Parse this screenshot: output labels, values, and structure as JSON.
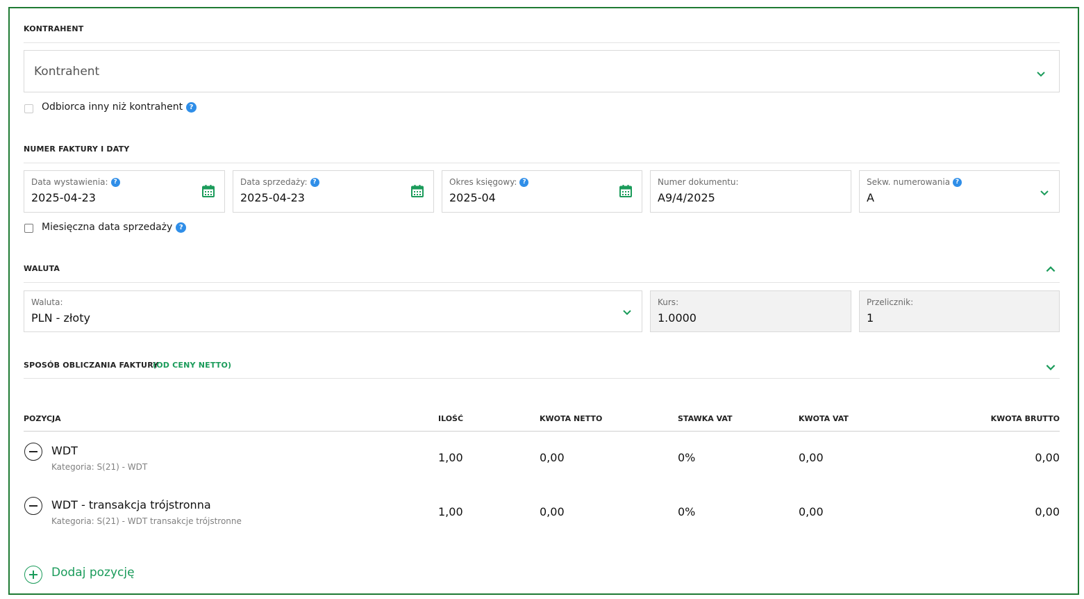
{
  "theme": {
    "accent": "#1a9b5a",
    "frame_border": "#1e7a33",
    "help_blue": "#2f8ee8"
  },
  "kontrahent": {
    "section_title": "KONTRAHENT",
    "select_placeholder": "Kontrahent",
    "recipient_checkbox_label": "Odbiorca inny niż kontrahent",
    "recipient_checked": false
  },
  "numer": {
    "section_title": "NUMER FAKTURY I DATY",
    "issue_date": {
      "label": "Data wystawienia:",
      "value": "2025-04-23"
    },
    "sale_date": {
      "label": "Data sprzedaży:",
      "value": "2025-04-23"
    },
    "period": {
      "label": "Okres księgowy:",
      "value": "2025-04"
    },
    "doc_number": {
      "label": "Numer dokumentu:",
      "value": "A9/4/2025"
    },
    "sequence": {
      "label": "Sekw. numerowania",
      "value": "A"
    },
    "monthly_checkbox_label": "Miesięczna data sprzedaży",
    "monthly_checked": false
  },
  "waluta": {
    "section_title": "WALUTA",
    "currency": {
      "label": "Waluta:",
      "value": "PLN - złoty"
    },
    "rate": {
      "label": "Kurs:",
      "value": "1.0000"
    },
    "converter": {
      "label": "Przelicznik:",
      "value": "1"
    }
  },
  "calc": {
    "section_title": "SPOSÓB OBLICZANIA FAKTURY",
    "mode": "(OD CENY NETTO)"
  },
  "table": {
    "headers": {
      "position": "POZYCJA",
      "qty": "ILOŚĆ",
      "net": "KWOTA NETTO",
      "vat_rate": "STAWKA VAT",
      "vat": "KWOTA VAT",
      "gross": "KWOTA BRUTTO"
    },
    "rows": [
      {
        "name": "WDT",
        "category": "Kategoria: S(21) - WDT",
        "qty": "1,00",
        "net": "0,00",
        "vat_rate": "0%",
        "vat": "0,00",
        "gross": "0,00"
      },
      {
        "name": "WDT - transakcja trójstronna",
        "category": "Kategoria: S(21) - WDT transakcje trójstronne",
        "qty": "1,00",
        "net": "0,00",
        "vat_rate": "0%",
        "vat": "0,00",
        "gross": "0,00"
      }
    ],
    "add_label": "Dodaj pozycję"
  },
  "icons": {
    "help": "?",
    "calendar": "calendar-icon",
    "chevron_down": "chevron-down-icon",
    "chevron_up": "chevron-up-icon"
  }
}
